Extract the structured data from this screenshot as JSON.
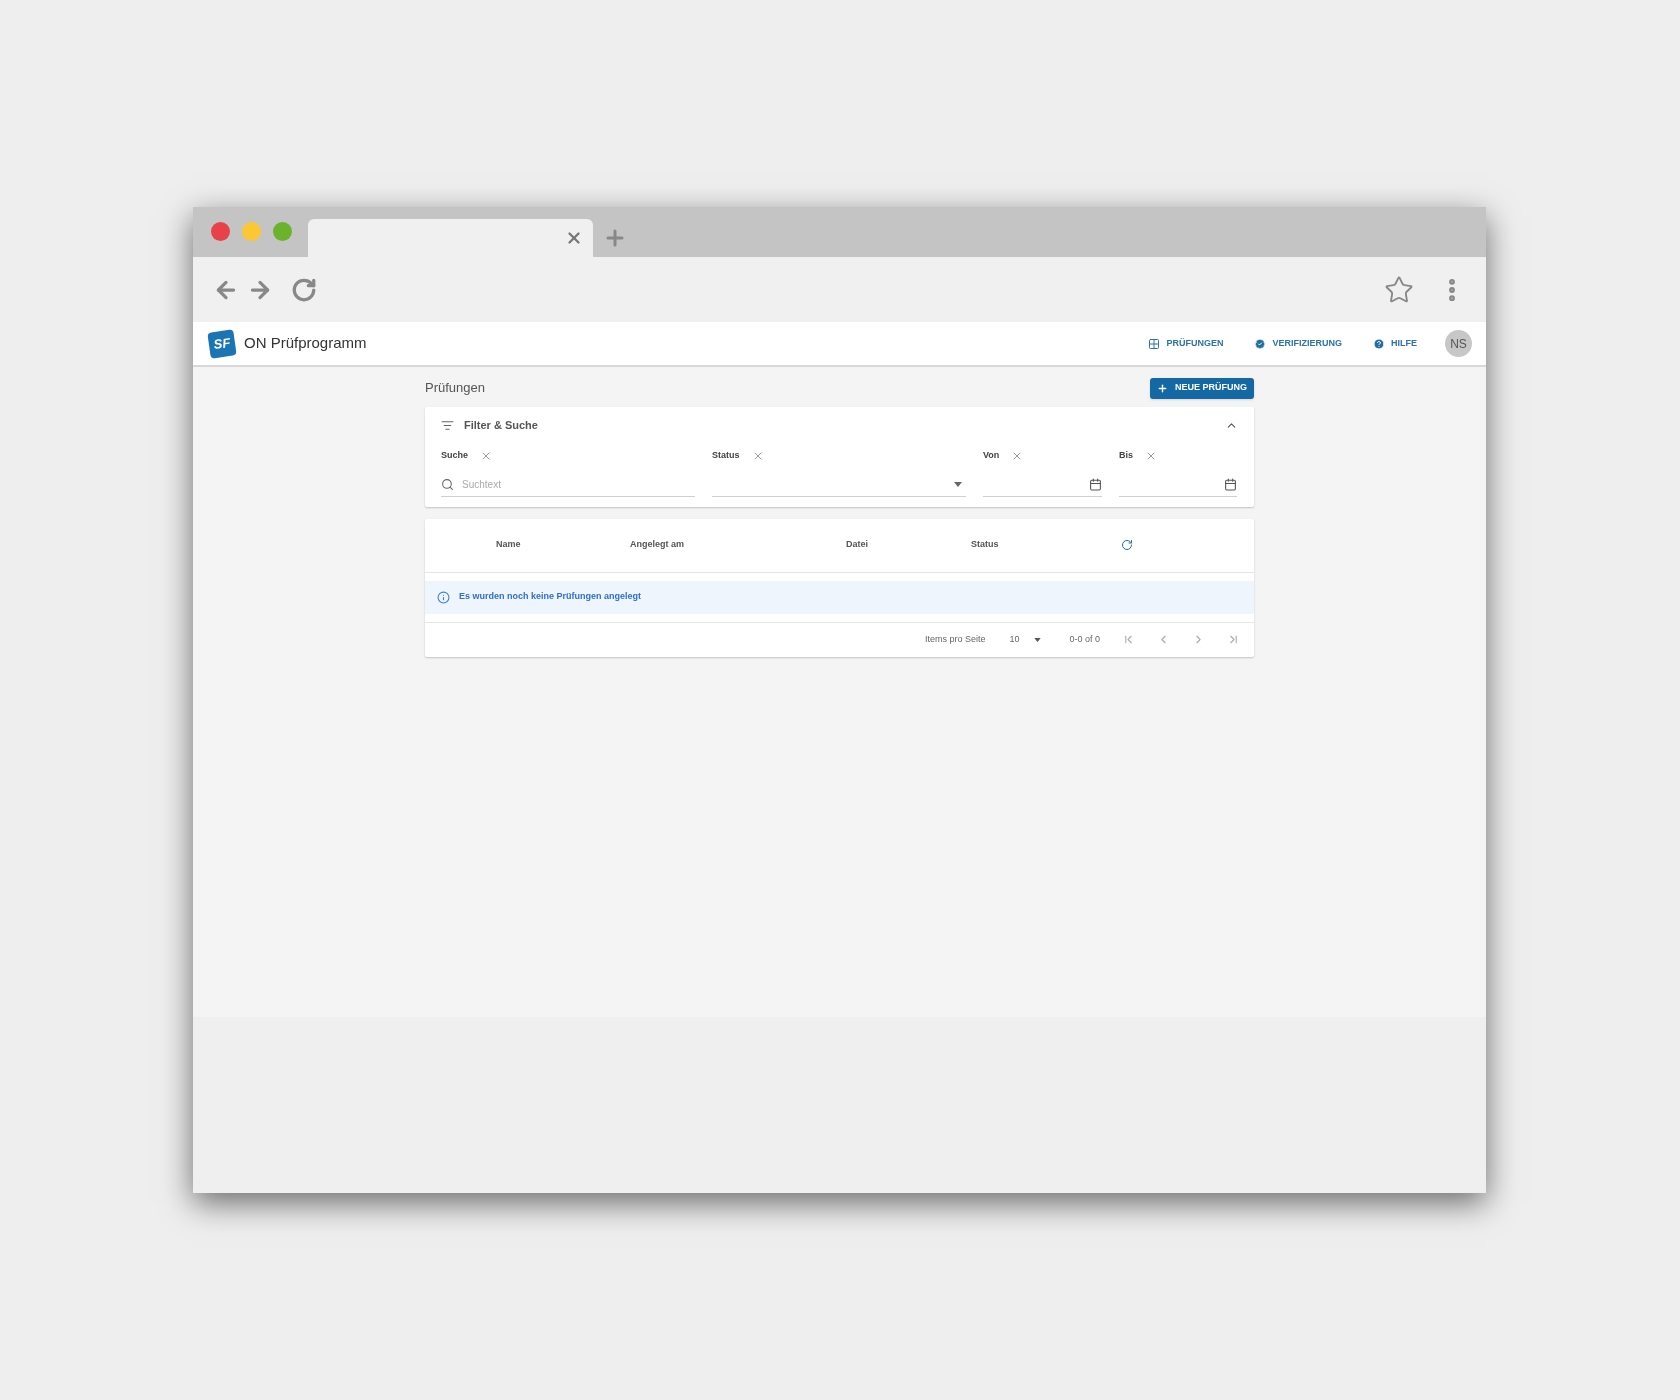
{
  "app": {
    "title": "ON Prüfprogramm",
    "logo": "SF",
    "nav": [
      {
        "label": "PRÜFUNGEN",
        "kind": "grid"
      },
      {
        "label": "VERIFIZIERUNG",
        "kind": "check"
      },
      {
        "label": "HILFE",
        "kind": "help"
      }
    ],
    "avatar": "NS"
  },
  "page": {
    "title": "Prüfungen",
    "new_button": "NEUE PRÜFUNG"
  },
  "filter": {
    "title": "Filter & Suche",
    "expanded": true,
    "fields": [
      {
        "label": "Suche",
        "kind": "text",
        "placeholder": "Suchtext"
      },
      {
        "label": "Status",
        "kind": "select"
      },
      {
        "label": "Von",
        "kind": "date"
      },
      {
        "label": "Bis",
        "kind": "date"
      }
    ]
  },
  "table": {
    "columns": [
      "Name",
      "Angelegt am",
      "Datei",
      "Status"
    ],
    "empty_message": "Es wurden noch keine Prüfungen angelegt"
  },
  "pagination": {
    "label": "Items pro Seite",
    "page_size": "10",
    "range": "0-0 of 0"
  }
}
